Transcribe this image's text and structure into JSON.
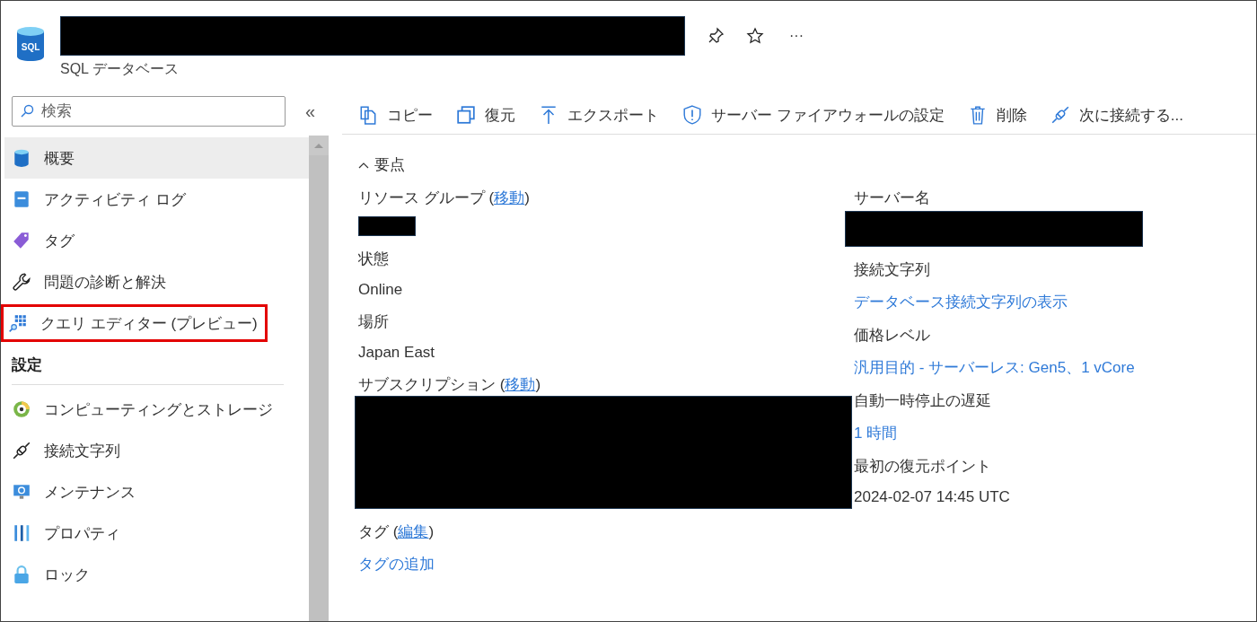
{
  "header": {
    "logo_text": "SQL",
    "title": {
      "kind": "redacted"
    },
    "subtitle": "SQL データベース",
    "more_label": "···"
  },
  "search": {
    "placeholder": "検索"
  },
  "collapse_label": "«",
  "sidebar": {
    "items": [
      {
        "label": "概要",
        "selected": true,
        "highlighted": false
      },
      {
        "label": "アクティビティ ログ",
        "selected": false,
        "highlighted": false
      },
      {
        "label": "タグ",
        "selected": false,
        "highlighted": false
      },
      {
        "label": "問題の診断と解決",
        "selected": false,
        "highlighted": false
      },
      {
        "label": "クエリ エディター (プレビュー)",
        "selected": false,
        "highlighted": true
      }
    ],
    "sections": [
      {
        "title": "設定",
        "items": [
          {
            "label": "コンピューティングとストレージ",
            "selected": false,
            "highlighted": false
          },
          {
            "label": "接続文字列",
            "selected": false,
            "highlighted": false
          },
          {
            "label": "メンテナンス",
            "selected": false,
            "highlighted": false
          },
          {
            "label": "プロパティ",
            "selected": false,
            "highlighted": false
          },
          {
            "label": "ロック",
            "selected": false,
            "highlighted": false
          }
        ]
      }
    ]
  },
  "toolbar": [
    {
      "label": "コピー"
    },
    {
      "label": "復元"
    },
    {
      "label": "エクスポート"
    },
    {
      "label": "サーバー ファイアウォールの設定"
    },
    {
      "label": "削除"
    },
    {
      "label": "次に接続する..."
    }
  ],
  "essentials": {
    "title": "要点",
    "expanded": true,
    "left": [
      {
        "label": "リソース グループ",
        "link_open": "(",
        "link": "移動",
        "link_close": ")",
        "value": {
          "kind": "redacted"
        }
      },
      {
        "label": "状態",
        "value": {
          "kind": "text",
          "text": "Online"
        }
      },
      {
        "label": "場所",
        "value": {
          "kind": "text",
          "text": "Japan East"
        }
      },
      {
        "label": "サブスクリプション",
        "link_open": "(",
        "link": "移動",
        "link_close": ")",
        "value": {
          "kind": "redacted"
        }
      },
      {
        "label": "タグ",
        "link_open": "(",
        "link": "編集",
        "link_close": ")",
        "value": {
          "kind": "link",
          "text": "タグの追加"
        }
      }
    ],
    "right": [
      {
        "label": "サーバー名",
        "value": {
          "kind": "redacted"
        }
      },
      {
        "label": "接続文字列",
        "value": {
          "kind": "link",
          "text": "データベース接続文字列の表示"
        }
      },
      {
        "label": "価格レベル",
        "value": {
          "kind": "link",
          "text": "汎用目的 - サーバーレス: Gen5、1 vCore"
        }
      },
      {
        "label": "自動一時停止の遅延",
        "value": {
          "kind": "link",
          "text": "1 時間"
        }
      },
      {
        "label": "最初の復元ポイント",
        "value": {
          "kind": "text",
          "text": "2024-02-07 14:45 UTC"
        }
      }
    ]
  }
}
